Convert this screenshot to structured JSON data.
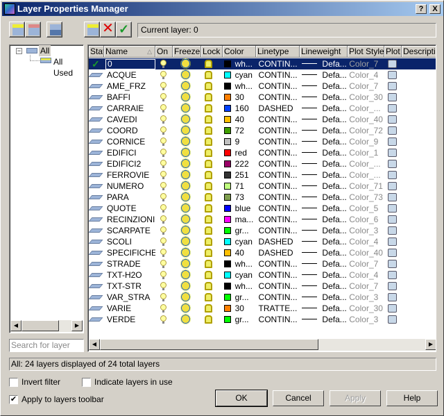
{
  "window": {
    "title": "Layer Properties Manager",
    "help_btn": "?",
    "close_btn": "X"
  },
  "toolbar": {
    "current_layer": "Current layer: 0"
  },
  "tree": {
    "root": "All",
    "child": "All Used",
    "expander": "−"
  },
  "search": {
    "placeholder": "Search for layer"
  },
  "columns": [
    "Stat",
    "Name",
    "On",
    "Freeze",
    "Lock",
    "Color",
    "Linetype",
    "Lineweight",
    "Plot Style",
    "Plot",
    "Descriptio"
  ],
  "sort_indicator": "△",
  "lineweight_label": "Defa...",
  "layers": [
    {
      "name": "0",
      "color": "#000000",
      "color_label": "wh...",
      "linetype": "CONTIN...",
      "plot_style": "Color_7",
      "current": true
    },
    {
      "name": "ACQUE",
      "color": "#00ffff",
      "color_label": "cyan",
      "linetype": "CONTIN...",
      "plot_style": "Color_4"
    },
    {
      "name": "AME_FRZ",
      "color": "#000000",
      "color_label": "wh...",
      "linetype": "CONTIN...",
      "plot_style": "Color_7"
    },
    {
      "name": "BAFFI",
      "color": "#ff7f00",
      "color_label": "30",
      "linetype": "CONTIN...",
      "plot_style": "Color_30"
    },
    {
      "name": "CARRAIE",
      "color": "#0040ff",
      "color_label": "160",
      "linetype": "DASHED",
      "plot_style": "Color_..."
    },
    {
      "name": "CAVEDI",
      "color": "#ffbf00",
      "color_label": "40",
      "linetype": "CONTIN...",
      "plot_style": "Color_40"
    },
    {
      "name": "COORD",
      "color": "#3f9f00",
      "color_label": "72",
      "linetype": "CONTIN...",
      "plot_style": "Color_72"
    },
    {
      "name": "CORNICE",
      "color": "#c0c0c0",
      "color_label": "9",
      "linetype": "CONTIN...",
      "plot_style": "Color_9"
    },
    {
      "name": "EDIFICI",
      "color": "#ff0000",
      "color_label": "red",
      "linetype": "CONTIN...",
      "plot_style": "Color_1"
    },
    {
      "name": "EDIFICI2",
      "color": "#990066",
      "color_label": "222",
      "linetype": "CONTIN...",
      "plot_style": "Color_..."
    },
    {
      "name": "FERROVIE",
      "color": "#333333",
      "color_label": "251",
      "linetype": "CONTIN...",
      "plot_style": "Color_..."
    },
    {
      "name": "NUMERO",
      "color": "#bfff7f",
      "color_label": "71",
      "linetype": "CONTIN...",
      "plot_style": "Color_71"
    },
    {
      "name": "PARA",
      "color": "#7f9f4f",
      "color_label": "73",
      "linetype": "CONTIN...",
      "plot_style": "Color_73"
    },
    {
      "name": "QUOTE",
      "color": "#0000ff",
      "color_label": "blue",
      "linetype": "CONTIN...",
      "plot_style": "Color_5"
    },
    {
      "name": "RECINZIONI",
      "color": "#ff00ff",
      "color_label": "ma...",
      "linetype": "CONTIN...",
      "plot_style": "Color_6"
    },
    {
      "name": "SCARPATE",
      "color": "#00ff00",
      "color_label": "gr...",
      "linetype": "CONTIN...",
      "plot_style": "Color_3"
    },
    {
      "name": "SCOLI",
      "color": "#00ffff",
      "color_label": "cyan",
      "linetype": "DASHED",
      "plot_style": "Color_4"
    },
    {
      "name": "SPECIFICHE",
      "color": "#ffbf00",
      "color_label": "40",
      "linetype": "DASHED",
      "plot_style": "Color_40"
    },
    {
      "name": "STRADE",
      "color": "#000000",
      "color_label": "wh...",
      "linetype": "CONTIN...",
      "plot_style": "Color_7"
    },
    {
      "name": "TXT-H2O",
      "color": "#00ffff",
      "color_label": "cyan",
      "linetype": "CONTIN...",
      "plot_style": "Color_4"
    },
    {
      "name": "TXT-STR",
      "color": "#000000",
      "color_label": "wh...",
      "linetype": "CONTIN...",
      "plot_style": "Color_7"
    },
    {
      "name": "VAR_STRA",
      "color": "#00ff00",
      "color_label": "gr...",
      "linetype": "CONTIN...",
      "plot_style": "Color_3"
    },
    {
      "name": "VARIE",
      "color": "#ff7f00",
      "color_label": "30",
      "linetype": "TRATTE...",
      "plot_style": "Color_30"
    },
    {
      "name": "VERDE",
      "color": "#00ff00",
      "color_label": "gr...",
      "linetype": "CONTIN...",
      "plot_style": "Color_3"
    }
  ],
  "status": "All: 24 layers displayed of 24 total layers",
  "options": {
    "invert_filter": {
      "label": "Invert filter",
      "checked": false
    },
    "indicate_in_use": {
      "label": "Indicate layers in use",
      "checked": false
    },
    "apply_toolbar": {
      "label": "Apply to layers toolbar",
      "checked": true
    }
  },
  "buttons": {
    "ok": "OK",
    "cancel": "Cancel",
    "apply": "Apply",
    "help": "Help"
  }
}
